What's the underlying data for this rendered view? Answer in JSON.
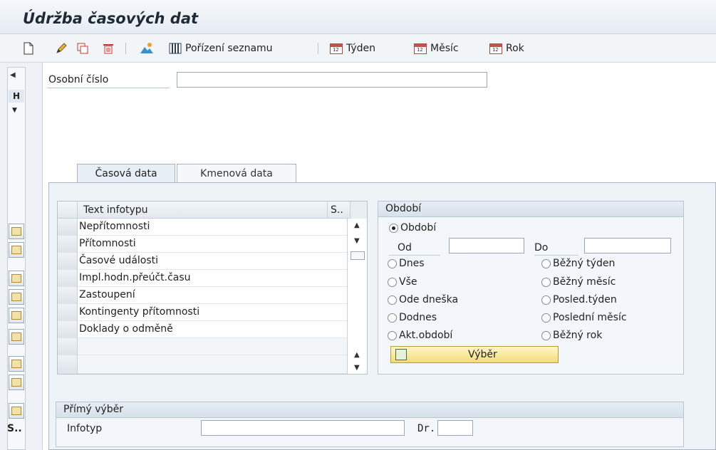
{
  "app": {
    "title": "Údržba časových dat"
  },
  "toolbar": {
    "list_label": "Pořízení seznamu",
    "week_label": "Týden",
    "month_label": "Měsíc",
    "year_label": "Rok",
    "calendar_badge": "12"
  },
  "left_rail": {
    "tab_letter": "H",
    "bottom_label": "S.."
  },
  "header": {
    "personal_number_label": "Osobní číslo",
    "personal_number_value": ""
  },
  "tabs": [
    {
      "label": "Časová data",
      "active": true
    },
    {
      "label": "Kmenová data",
      "active": false
    }
  ],
  "table": {
    "col_text": "Text infotypu",
    "col_s": "S..",
    "rows": [
      "Nepřítomnosti",
      "Přítomnosti",
      "Časové události",
      "Impl.hodn.přeúčt.času",
      "Zastoupení",
      "Kontingenty přítomnosti",
      "Doklady o odměně"
    ]
  },
  "period": {
    "title": "Období",
    "radio_period": "Období",
    "from_label": "Od",
    "from_value": "",
    "to_label": "Do",
    "to_value": "",
    "left_options": [
      "Dnes",
      "Vše",
      "Ode dneška",
      "Dodnes",
      "Akt.období"
    ],
    "right_options": [
      "Běžný týden",
      "Běžný měsíc",
      "Posled.týden",
      "Poslední měsíc",
      "Běžný rok"
    ],
    "selected": "Období",
    "button_label": "Výběr"
  },
  "direct": {
    "title": "Přímý výběr",
    "infotype_label": "Infotyp",
    "infotype_value": "",
    "subtype_label": "Dr.",
    "subtype_value": ""
  }
}
